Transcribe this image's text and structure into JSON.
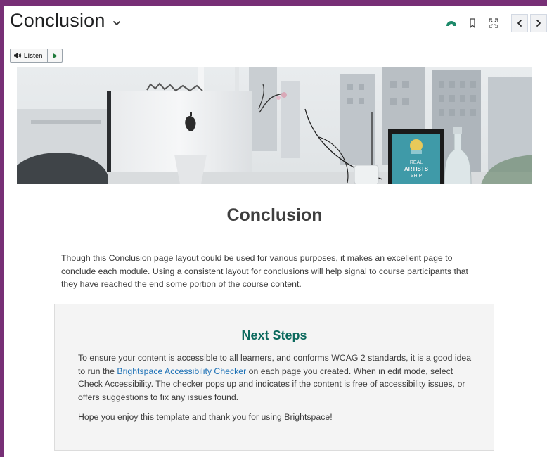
{
  "header": {
    "title": "Conclusion",
    "icons": [
      "chevron-down-icon",
      "progress-icon",
      "bookmark-icon",
      "fullscreen-icon",
      "previous-icon",
      "next-icon"
    ]
  },
  "listen": {
    "label": "Listen"
  },
  "hero_image": {
    "poster_lines": [
      "REAL",
      "ARTISTS",
      "SHIP"
    ]
  },
  "content": {
    "title": "Conclusion",
    "intro": "Though this Conclusion page layout could be used for various purposes, it makes an excellent page to conclude each module. Using a consistent layout for conclusions will help signal to course participants that they have reached the end some portion of the course content."
  },
  "next_steps": {
    "title": "Next Steps",
    "paragraph1_before": "To ensure your content is accessible to all learners, and conforms WCAG 2 standards, it is a good idea to run the ",
    "link_text": "Brightspace Accessibility Checker",
    "paragraph1_after": " on each page you created. When in edit mode, select Check Accessibility. The checker pops up and indicates if the content is free of accessibility issues, or offers suggestions to fix any issues found.",
    "paragraph2": "Hope you enjoy this template and thank you for using Brightspace!"
  },
  "colors": {
    "frame": "#772f76",
    "accent_green": "#0d6a5e",
    "link": "#1a6fb5",
    "progress_icon": "#1d8a6a"
  }
}
